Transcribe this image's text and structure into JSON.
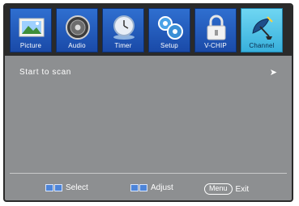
{
  "tabs": [
    {
      "label": "Picture",
      "icon": "picture-icon"
    },
    {
      "label": "Audio",
      "icon": "speaker-icon"
    },
    {
      "label": "Timer",
      "icon": "clock-icon"
    },
    {
      "label": "Setup",
      "icon": "gears-icon"
    },
    {
      "label": "V-CHIP",
      "icon": "padlock-icon"
    },
    {
      "label": "Channel",
      "icon": "satellite-dish-icon"
    }
  ],
  "active_tab": "Channel",
  "menu": {
    "items": [
      {
        "label": "Start to scan",
        "arrow": "➤"
      }
    ]
  },
  "footer": {
    "select_label": "Select",
    "adjust_label": "Adjust",
    "menu_key": "Menu",
    "exit_label": "Exit"
  },
  "colors": {
    "panel": "#8d8f91",
    "tab_blue": "#2f6fd0",
    "tab_active": "#6fd6f2",
    "frame": "#2a2a2a"
  }
}
